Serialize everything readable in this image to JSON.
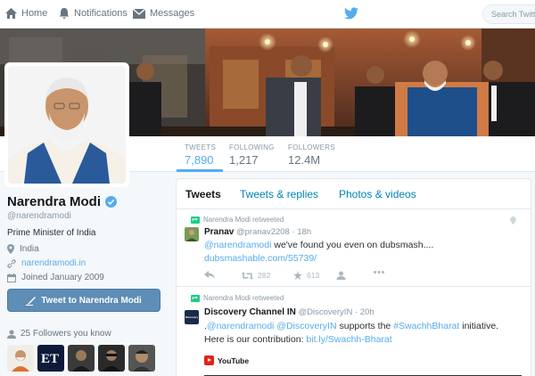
{
  "nav": {
    "home_label": "Home",
    "notifications_label": "Notifications",
    "messages_label": "Messages",
    "search_placeholder": "Search Twitter"
  },
  "profile_nav": {
    "tweets_label": "TWEETS",
    "tweets_count": "7,890",
    "following_label": "FOLLOWING",
    "following_count": "1,217",
    "followers_label": "FOLLOWERS",
    "followers_count": "12.4M"
  },
  "profile": {
    "name": "Narendra Modi",
    "handle": "@narendramodi",
    "bio": "Prime Minister of India",
    "location": "India",
    "website": "narendramodi.in",
    "joined": "Joined January 2009",
    "tweet_to_label": "Tweet to Narendra Modi",
    "followers_you_know": "25 Followers you know"
  },
  "timeline": {
    "tabs": [
      "Tweets",
      "Tweets & replies",
      "Photos & videos"
    ],
    "tweets": [
      {
        "retweeted_by": "Narendra Modi retweeted",
        "author": "Pranav",
        "handle": "@pranav2208",
        "time": "· 18h",
        "text_mention": "@narendramodi",
        "text_body": " we've found you even on dubsmash....",
        "link": "dubsmashable.com/55739/",
        "retweets": "282",
        "favorites": "613"
      },
      {
        "retweeted_by": "Narendra Modi retweeted",
        "author": "Discovery Channel IN",
        "handle": "@DiscoveryIN",
        "time": "· 20h",
        "avatar_text": "Discovery",
        "line1_pre": ".",
        "mention1": "@narendramodi",
        "mention2": "@DiscoveryIN",
        "line1_mid": " supports the ",
        "hashtag": "#SwachhBharat",
        "line1_end": " initiative.",
        "line2_pre": "Here is our contribution: ",
        "link": "bit.ly/Swachh-Bharat",
        "card_label": "YouTube"
      }
    ]
  },
  "colors": {
    "accent": "#55acee",
    "button": "#5e8db6",
    "retweet_green": "#19cf86"
  }
}
